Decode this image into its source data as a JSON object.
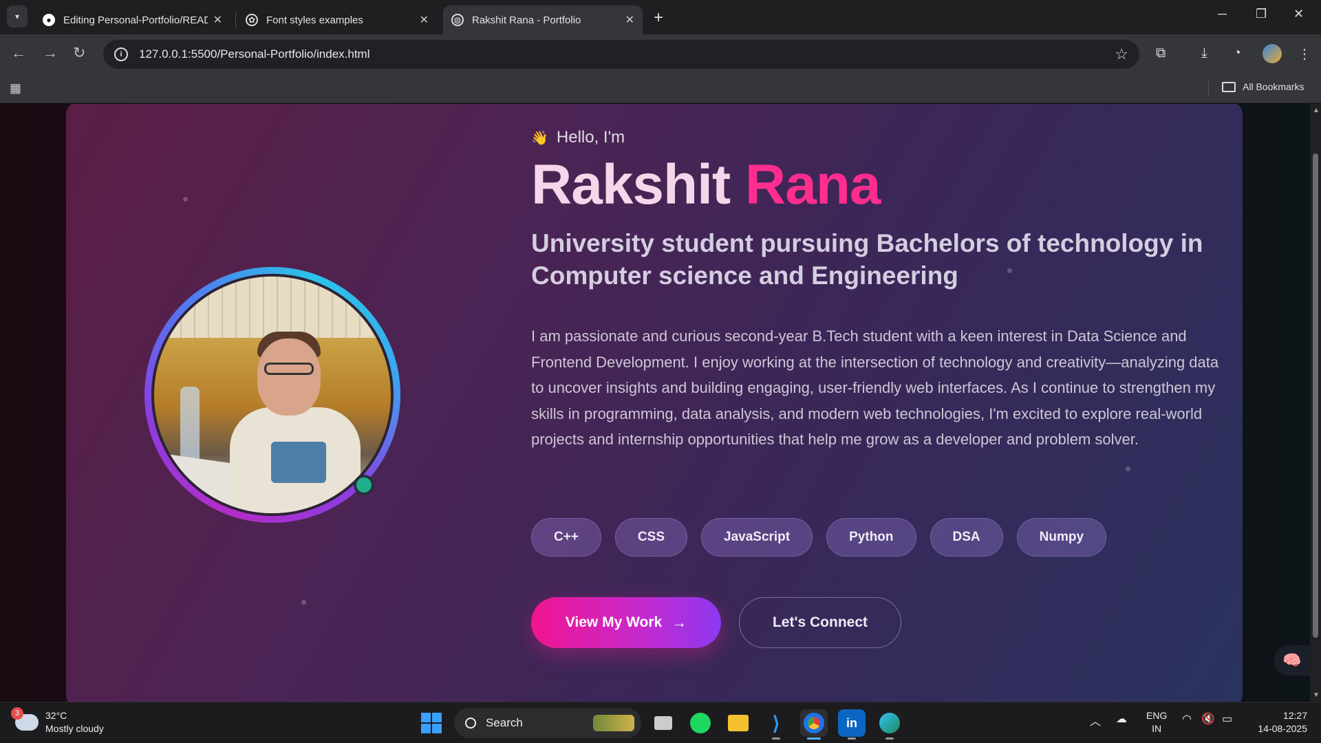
{
  "browser": {
    "tabs": [
      {
        "title": "Editing Personal-Portfolio/READ",
        "icon": "github-icon"
      },
      {
        "title": "Font styles examples",
        "icon": "openai-icon"
      },
      {
        "title": "Rakshit Rana - Portfolio",
        "icon": "globe-icon",
        "active": true
      }
    ],
    "url": "127.0.0.1:5500/Personal-Portfolio/index.html",
    "bookmarks_label": "All Bookmarks"
  },
  "hero": {
    "greeting": "Hello, I'm",
    "first_name": "Rakshit",
    "last_name": "Rana",
    "subtitle": "University student pursuing Bachelors of technology in Computer science and Engineering",
    "bio": "I am passionate and curious second-year B.Tech student with a keen interest in Data Science and Frontend Development. I enjoy working at the intersection of technology and creativity—analyzing data to uncover insights and building engaging, user-friendly web interfaces. As I continue to strengthen my skills in programming, data analysis, and modern web technologies, I'm excited to explore real-world projects and internship opportunities that help me grow as a developer and problem solver.",
    "skills": [
      "C++",
      "CSS",
      "JavaScript",
      "Python",
      "DSA",
      "Numpy"
    ],
    "primary_button": "View My Work",
    "primary_arrow": "→",
    "secondary_button": "Let's Connect"
  },
  "taskbar": {
    "weather_badge": "3",
    "temperature": "32°C",
    "condition": "Mostly cloudy",
    "search_placeholder": "Search",
    "lang_top": "ENG",
    "lang_bottom": "IN",
    "time": "12:27",
    "date": "14-08-2025"
  },
  "colors": {
    "accent_pink": "#ff2e8e",
    "primary_gradient_start": "#f2158f",
    "primary_gradient_end": "#8d39f0"
  }
}
